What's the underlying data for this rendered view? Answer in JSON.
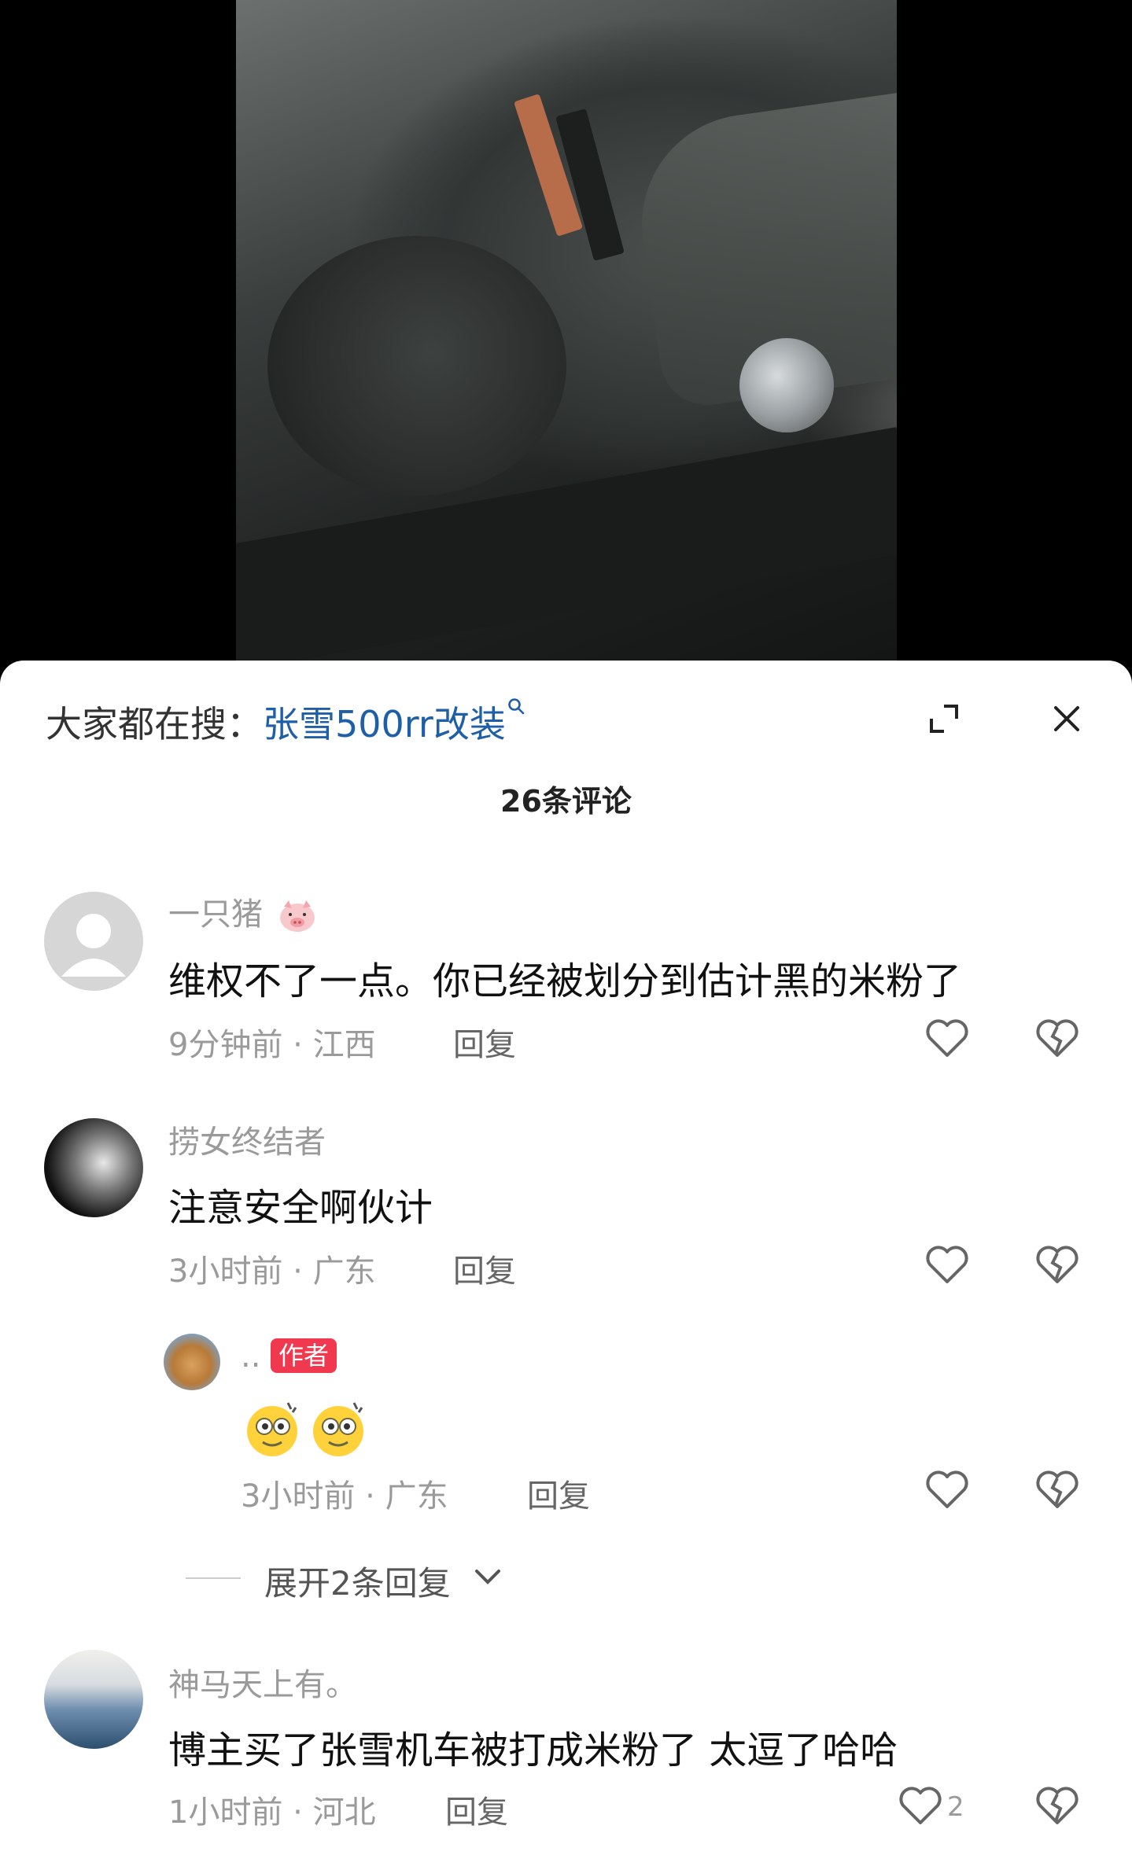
{
  "search": {
    "prefix": "大家都在搜：",
    "query": "张雪500rr改装"
  },
  "sheet": {
    "comment_count": "26条评论"
  },
  "comments": [
    {
      "user": "一只猪",
      "text": "维权不了一点。你已经被划分到估计黑的米粉了",
      "time": "9分钟前",
      "location": "江西",
      "reply_label": "回复"
    },
    {
      "user": "捞女终结者",
      "text": "注意安全啊伙计",
      "time": "3小时前",
      "location": "广东",
      "reply_label": "回复",
      "replies": [
        {
          "user": "..",
          "badge": "作者",
          "time": "3小时前",
          "location": "广东",
          "reply_label": "回复"
        }
      ],
      "expand_label": "展开2条回复"
    },
    {
      "user": "神马天上有。",
      "text": "博主买了张雪机车被打成米粉了 太逗了哈哈",
      "time": "1小时前",
      "location": "河北",
      "reply_label": "回复",
      "like_count": "2"
    }
  ],
  "colors": {
    "link": "#1f5fa8",
    "badge": "#f0384f",
    "meta": "#9a9a9a"
  },
  "icons": {
    "expand": "expand-icon",
    "close": "close-icon",
    "like": "heart-icon",
    "dislike": "broken-heart-icon",
    "search": "search-icon"
  }
}
